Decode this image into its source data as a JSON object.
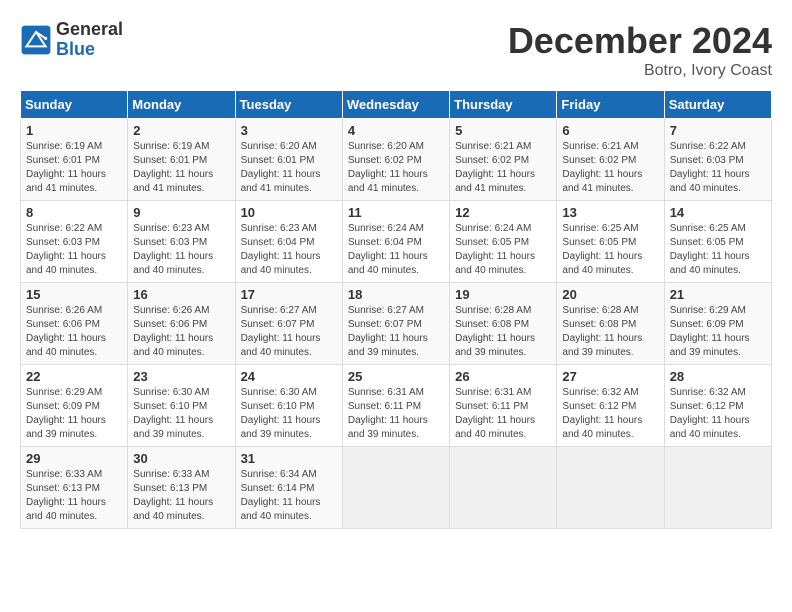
{
  "header": {
    "logo_general": "General",
    "logo_blue": "Blue",
    "month_title": "December 2024",
    "location": "Botro, Ivory Coast"
  },
  "days_of_week": [
    "Sunday",
    "Monday",
    "Tuesday",
    "Wednesday",
    "Thursday",
    "Friday",
    "Saturday"
  ],
  "weeks": [
    [
      {
        "day": "1",
        "sunrise": "6:19 AM",
        "sunset": "6:01 PM",
        "daylight": "11 hours and 41 minutes"
      },
      {
        "day": "2",
        "sunrise": "6:19 AM",
        "sunset": "6:01 PM",
        "daylight": "11 hours and 41 minutes"
      },
      {
        "day": "3",
        "sunrise": "6:20 AM",
        "sunset": "6:01 PM",
        "daylight": "11 hours and 41 minutes"
      },
      {
        "day": "4",
        "sunrise": "6:20 AM",
        "sunset": "6:02 PM",
        "daylight": "11 hours and 41 minutes"
      },
      {
        "day": "5",
        "sunrise": "6:21 AM",
        "sunset": "6:02 PM",
        "daylight": "11 hours and 41 minutes"
      },
      {
        "day": "6",
        "sunrise": "6:21 AM",
        "sunset": "6:02 PM",
        "daylight": "11 hours and 41 minutes"
      },
      {
        "day": "7",
        "sunrise": "6:22 AM",
        "sunset": "6:03 PM",
        "daylight": "11 hours and 40 minutes"
      }
    ],
    [
      {
        "day": "8",
        "sunrise": "6:22 AM",
        "sunset": "6:03 PM",
        "daylight": "11 hours and 40 minutes"
      },
      {
        "day": "9",
        "sunrise": "6:23 AM",
        "sunset": "6:03 PM",
        "daylight": "11 hours and 40 minutes"
      },
      {
        "day": "10",
        "sunrise": "6:23 AM",
        "sunset": "6:04 PM",
        "daylight": "11 hours and 40 minutes"
      },
      {
        "day": "11",
        "sunrise": "6:24 AM",
        "sunset": "6:04 PM",
        "daylight": "11 hours and 40 minutes"
      },
      {
        "day": "12",
        "sunrise": "6:24 AM",
        "sunset": "6:05 PM",
        "daylight": "11 hours and 40 minutes"
      },
      {
        "day": "13",
        "sunrise": "6:25 AM",
        "sunset": "6:05 PM",
        "daylight": "11 hours and 40 minutes"
      },
      {
        "day": "14",
        "sunrise": "6:25 AM",
        "sunset": "6:05 PM",
        "daylight": "11 hours and 40 minutes"
      }
    ],
    [
      {
        "day": "15",
        "sunrise": "6:26 AM",
        "sunset": "6:06 PM",
        "daylight": "11 hours and 40 minutes"
      },
      {
        "day": "16",
        "sunrise": "6:26 AM",
        "sunset": "6:06 PM",
        "daylight": "11 hours and 40 minutes"
      },
      {
        "day": "17",
        "sunrise": "6:27 AM",
        "sunset": "6:07 PM",
        "daylight": "11 hours and 40 minutes"
      },
      {
        "day": "18",
        "sunrise": "6:27 AM",
        "sunset": "6:07 PM",
        "daylight": "11 hours and 39 minutes"
      },
      {
        "day": "19",
        "sunrise": "6:28 AM",
        "sunset": "6:08 PM",
        "daylight": "11 hours and 39 minutes"
      },
      {
        "day": "20",
        "sunrise": "6:28 AM",
        "sunset": "6:08 PM",
        "daylight": "11 hours and 39 minutes"
      },
      {
        "day": "21",
        "sunrise": "6:29 AM",
        "sunset": "6:09 PM",
        "daylight": "11 hours and 39 minutes"
      }
    ],
    [
      {
        "day": "22",
        "sunrise": "6:29 AM",
        "sunset": "6:09 PM",
        "daylight": "11 hours and 39 minutes"
      },
      {
        "day": "23",
        "sunrise": "6:30 AM",
        "sunset": "6:10 PM",
        "daylight": "11 hours and 39 minutes"
      },
      {
        "day": "24",
        "sunrise": "6:30 AM",
        "sunset": "6:10 PM",
        "daylight": "11 hours and 39 minutes"
      },
      {
        "day": "25",
        "sunrise": "6:31 AM",
        "sunset": "6:11 PM",
        "daylight": "11 hours and 39 minutes"
      },
      {
        "day": "26",
        "sunrise": "6:31 AM",
        "sunset": "6:11 PM",
        "daylight": "11 hours and 40 minutes"
      },
      {
        "day": "27",
        "sunrise": "6:32 AM",
        "sunset": "6:12 PM",
        "daylight": "11 hours and 40 minutes"
      },
      {
        "day": "28",
        "sunrise": "6:32 AM",
        "sunset": "6:12 PM",
        "daylight": "11 hours and 40 minutes"
      }
    ],
    [
      {
        "day": "29",
        "sunrise": "6:33 AM",
        "sunset": "6:13 PM",
        "daylight": "11 hours and 40 minutes"
      },
      {
        "day": "30",
        "sunrise": "6:33 AM",
        "sunset": "6:13 PM",
        "daylight": "11 hours and 40 minutes"
      },
      {
        "day": "31",
        "sunrise": "6:34 AM",
        "sunset": "6:14 PM",
        "daylight": "11 hours and 40 minutes"
      },
      null,
      null,
      null,
      null
    ]
  ]
}
